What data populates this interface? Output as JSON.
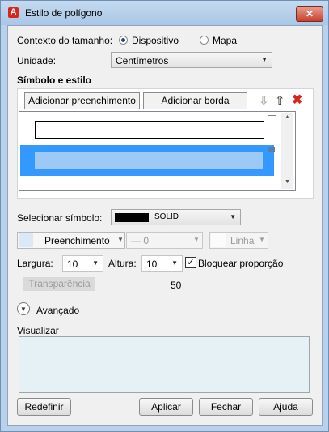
{
  "window": {
    "title": "Estilo de polígono",
    "app_icon": "autocad-icon"
  },
  "size_context": {
    "label": "Contexto do tamanho:",
    "options": [
      "Dispositivo",
      "Mapa"
    ],
    "selected": "Dispositivo"
  },
  "unit": {
    "label": "Unidade:",
    "value": "Centímetros"
  },
  "symbol_section": {
    "title": "Símbolo e estilo",
    "add_fill": "Adicionar preenchimento",
    "add_border": "Adicionar borda"
  },
  "select_symbol": {
    "label": "Selecionar símbolo:",
    "value": "SOLID"
  },
  "fill_row": {
    "fill_label": "Preenchimento",
    "line_weight": "— 0",
    "line_label": "Linha"
  },
  "width": {
    "label": "Largura:",
    "value": "10"
  },
  "height": {
    "label": "Altura:",
    "value": "10"
  },
  "lock_ratio": {
    "label": "Bloquear proporção",
    "checked": true
  },
  "transparency": {
    "label": "Transparência",
    "value": "50"
  },
  "advanced": {
    "label": "Avançado"
  },
  "preview": {
    "label": "Visualizar"
  },
  "buttons": {
    "reset": "Redefinir",
    "apply": "Aplicar",
    "close": "Fechar",
    "help": "Ajuda"
  },
  "colors": {
    "selection": "#3399ff",
    "selection_light": "#9cc9f5",
    "title_bar": "#b9d1ea",
    "preview_bg": "#e6f1f5"
  }
}
